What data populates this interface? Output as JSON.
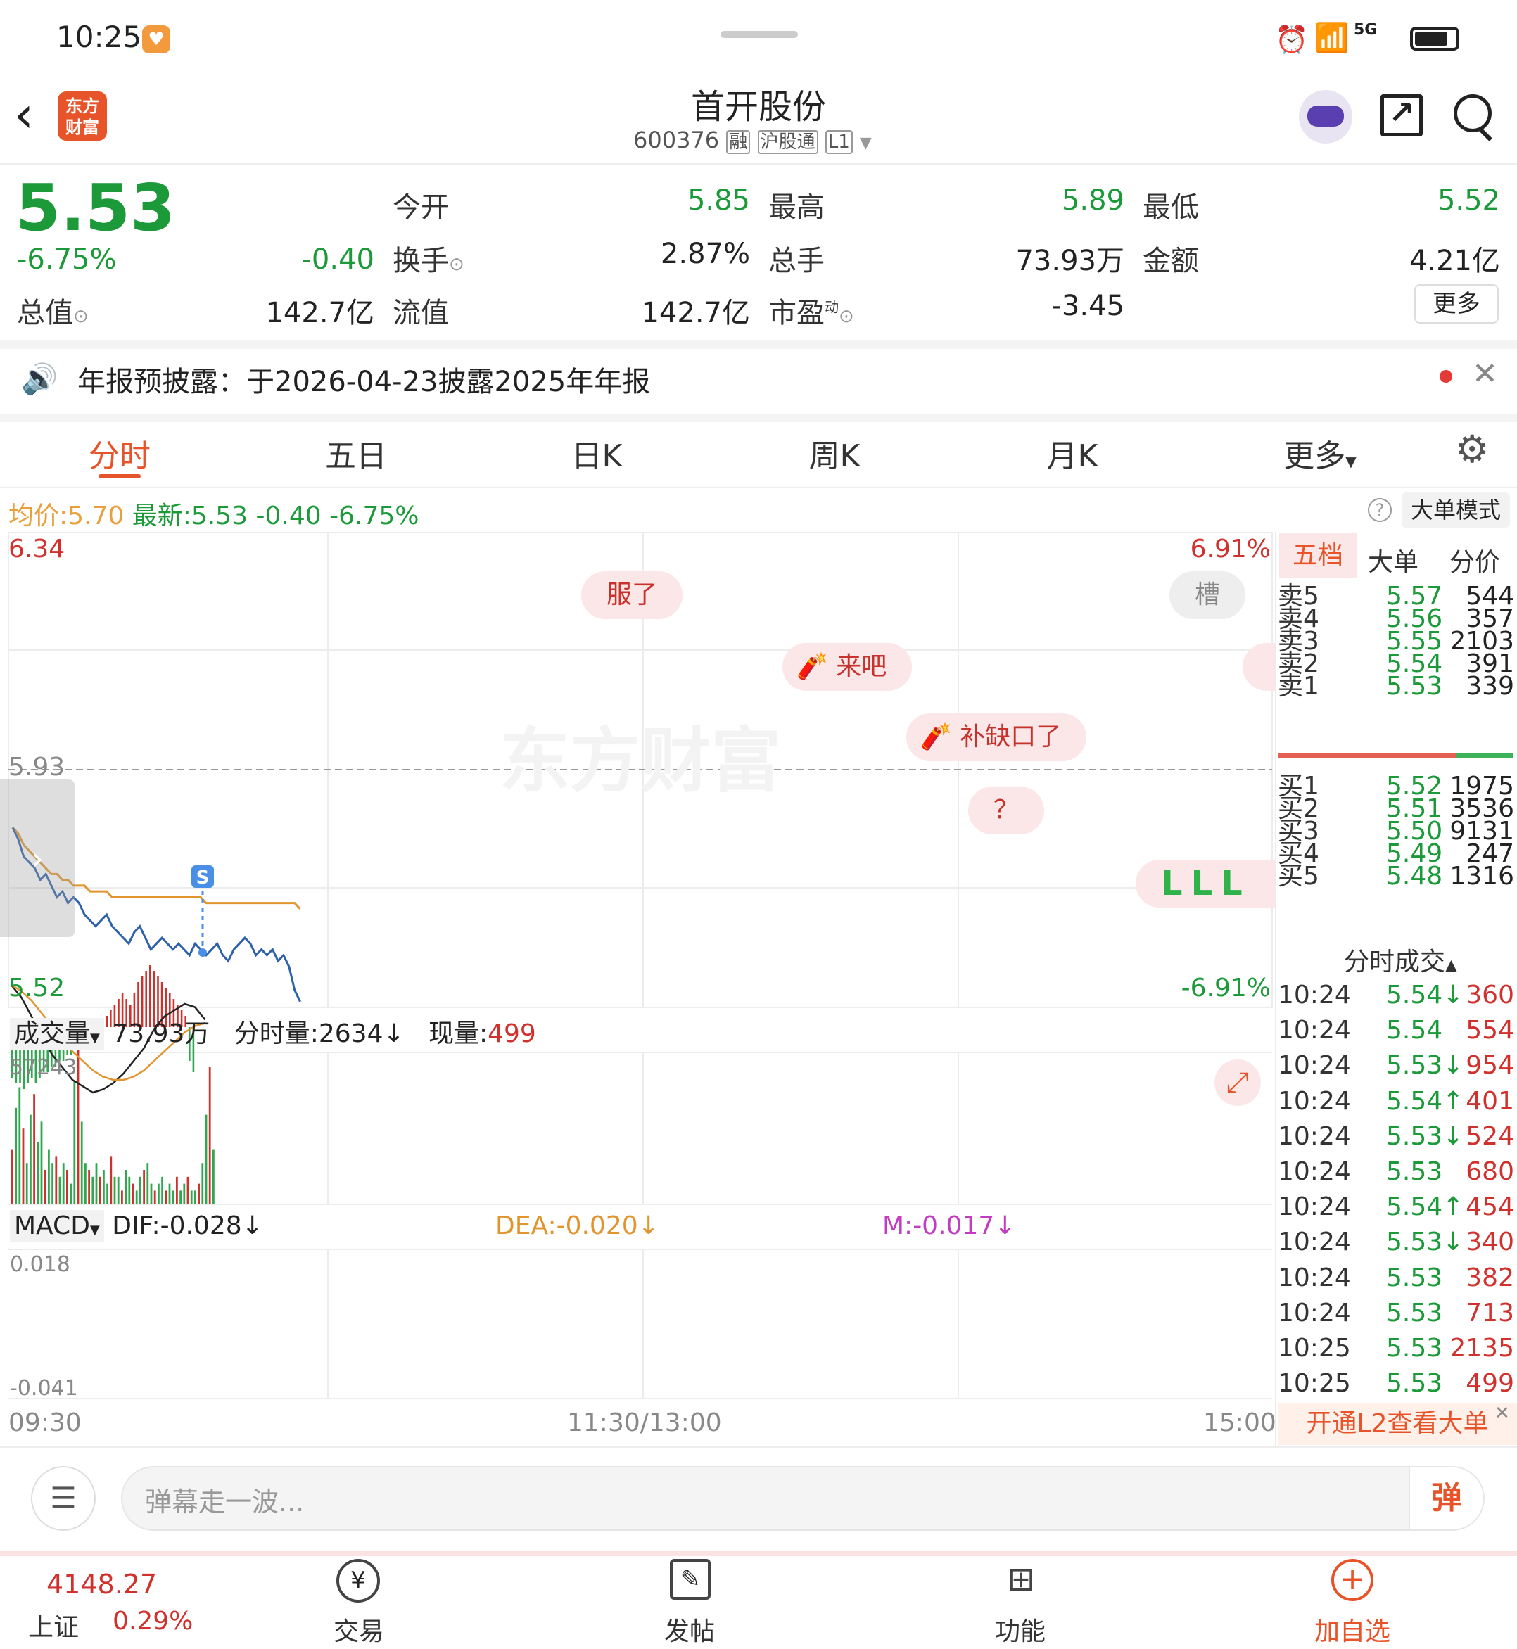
{
  "status": {
    "time": "10:25",
    "network": "5G"
  },
  "header": {
    "title": "首开股份",
    "code": "600376",
    "tags": [
      "融",
      "沪股通",
      "L1"
    ],
    "logo": "东方\n财富"
  },
  "quote": {
    "price": "5.53",
    "pct": "-6.75%",
    "chg": "-0.40",
    "fields": [
      {
        "label": "今开",
        "value": "5.85",
        "color": "green"
      },
      {
        "label": "最高",
        "value": "5.89",
        "color": "green"
      },
      {
        "label": "最低",
        "value": "5.52",
        "color": "green"
      },
      {
        "label": "换手",
        "value": "2.87%",
        "color": "black"
      },
      {
        "label": "总手",
        "value": "73.93万",
        "color": "black"
      },
      {
        "label": "金额",
        "value": "4.21亿",
        "color": "black"
      },
      {
        "label": "总值",
        "value": "142.7亿",
        "color": "black"
      },
      {
        "label": "流值",
        "value": "142.7亿",
        "color": "black"
      },
      {
        "label": "市盈",
        "value": "-3.45",
        "color": "black"
      }
    ],
    "more": "更多",
    "pe_sup": "动"
  },
  "notice": {
    "text": "年报预披露：于2026-04-23披露2025年年报"
  },
  "tabs": [
    "分时",
    "五日",
    "日K",
    "周K",
    "月K",
    "更多"
  ],
  "active_tab": "分时",
  "chart_info": {
    "avg_label": "均价:",
    "avg": "5.70",
    "latest_label": "最新:",
    "latest": "5.53",
    "chg": "-0.40",
    "pct": "-6.75%",
    "mode": "大单模式"
  },
  "chart_data": {
    "type": "line",
    "y_top": "6.34",
    "y_mid": "5.93",
    "y_bottom": "5.52",
    "pct_top": "6.91%",
    "pct_bottom": "-6.91%",
    "x_labels": [
      "09:30",
      "11:30/13:00",
      "15:00"
    ],
    "ylim": [
      5.52,
      6.34
    ],
    "series": [],
    "price": [
      5.83,
      5.81,
      5.78,
      5.77,
      5.76,
      5.74,
      5.75,
      5.73,
      5.71,
      5.72,
      5.7,
      5.71,
      5.7,
      5.68,
      5.67,
      5.66,
      5.67,
      5.68,
      5.66,
      5.65,
      5.64,
      5.63,
      5.65,
      5.66,
      5.64,
      5.62,
      5.63,
      5.64,
      5.63,
      5.62,
      5.63,
      5.62,
      5.61,
      5.63,
      5.62,
      5.61,
      5.62,
      5.63,
      5.61,
      5.6,
      5.62,
      5.63,
      5.64,
      5.63,
      5.61,
      5.62,
      5.61,
      5.62,
      5.6,
      5.61,
      5.59,
      5.55,
      5.53
    ],
    "avg": [
      5.83,
      5.82,
      5.8,
      5.79,
      5.78,
      5.77,
      5.76,
      5.75,
      5.75,
      5.74,
      5.74,
      5.73,
      5.73,
      5.73,
      5.72,
      5.72,
      5.72,
      5.72,
      5.71,
      5.71,
      5.71,
      5.71,
      5.71,
      5.71,
      5.71,
      5.71,
      5.71,
      5.71,
      5.71,
      5.71,
      5.71,
      5.71,
      5.71,
      5.71,
      5.71,
      5.7,
      5.7,
      5.7,
      5.7,
      5.7,
      5.7,
      5.7,
      5.7,
      5.7,
      5.7,
      5.7,
      5.7,
      5.7,
      5.7,
      5.7,
      5.7,
      5.7,
      5.69
    ]
  },
  "danmu": [
    {
      "text": "服了"
    },
    {
      "text": "来吧"
    },
    {
      "text": "补缺口了"
    },
    {
      "text": "？"
    },
    {
      "text": "槽"
    }
  ],
  "volume": {
    "label": "成交量",
    "total": "73.93万",
    "fen_label": "分时量:",
    "fen": "2634",
    "now_label": "现量:",
    "now": "499",
    "max": "57243"
  },
  "macd": {
    "label": "MACD",
    "dif": "DIF:-0.028",
    "dea": "DEA:-0.020",
    "m": "M:-0.017",
    "top": "0.018",
    "bottom": "-0.041"
  },
  "orderbook": {
    "tabs": [
      "五档",
      "大单",
      "分价"
    ],
    "sells": [
      {
        "l": "卖5",
        "p": "5.57",
        "v": "544"
      },
      {
        "l": "卖4",
        "p": "5.56",
        "v": "357"
      },
      {
        "l": "卖3",
        "p": "5.55",
        "v": "2103"
      },
      {
        "l": "卖2",
        "p": "5.54",
        "v": "391"
      },
      {
        "l": "卖1",
        "p": "5.53",
        "v": "339"
      }
    ],
    "buys": [
      {
        "l": "买1",
        "p": "5.52",
        "v": "1975"
      },
      {
        "l": "买2",
        "p": "5.51",
        "v": "3536"
      },
      {
        "l": "买3",
        "p": "5.50",
        "v": "9131"
      },
      {
        "l": "买4",
        "p": "5.49",
        "v": "247"
      },
      {
        "l": "买5",
        "p": "5.48",
        "v": "1316"
      }
    ],
    "trades_title": "分时成交",
    "trades": [
      {
        "t": "10:24",
        "p": "5.54↓",
        "v": "360"
      },
      {
        "t": "10:24",
        "p": "5.54",
        "v": "554"
      },
      {
        "t": "10:24",
        "p": "5.53↓",
        "v": "954"
      },
      {
        "t": "10:24",
        "p": "5.54↑",
        "v": "401"
      },
      {
        "t": "10:24",
        "p": "5.53↓",
        "v": "524"
      },
      {
        "t": "10:24",
        "p": "5.53",
        "v": "680"
      },
      {
        "t": "10:24",
        "p": "5.54↑",
        "v": "454"
      },
      {
        "t": "10:24",
        "p": "5.53↓",
        "v": "340"
      },
      {
        "t": "10:24",
        "p": "5.53",
        "v": "382"
      },
      {
        "t": "10:24",
        "p": "5.53",
        "v": "713"
      },
      {
        "t": "10:25",
        "p": "5.53",
        "v": "2135"
      },
      {
        "t": "10:25",
        "p": "5.53",
        "v": "499"
      }
    ],
    "l2": "开通L2查看大单"
  },
  "comment": {
    "placeholder": "弹幕走一波...",
    "btn": "弹"
  },
  "bottom": {
    "index_value": "4148.27",
    "index_name": "上证",
    "index_pct": "0.29%",
    "items": [
      "交易",
      "发帖",
      "功能",
      "加自选"
    ]
  },
  "watermark": "东方财富"
}
